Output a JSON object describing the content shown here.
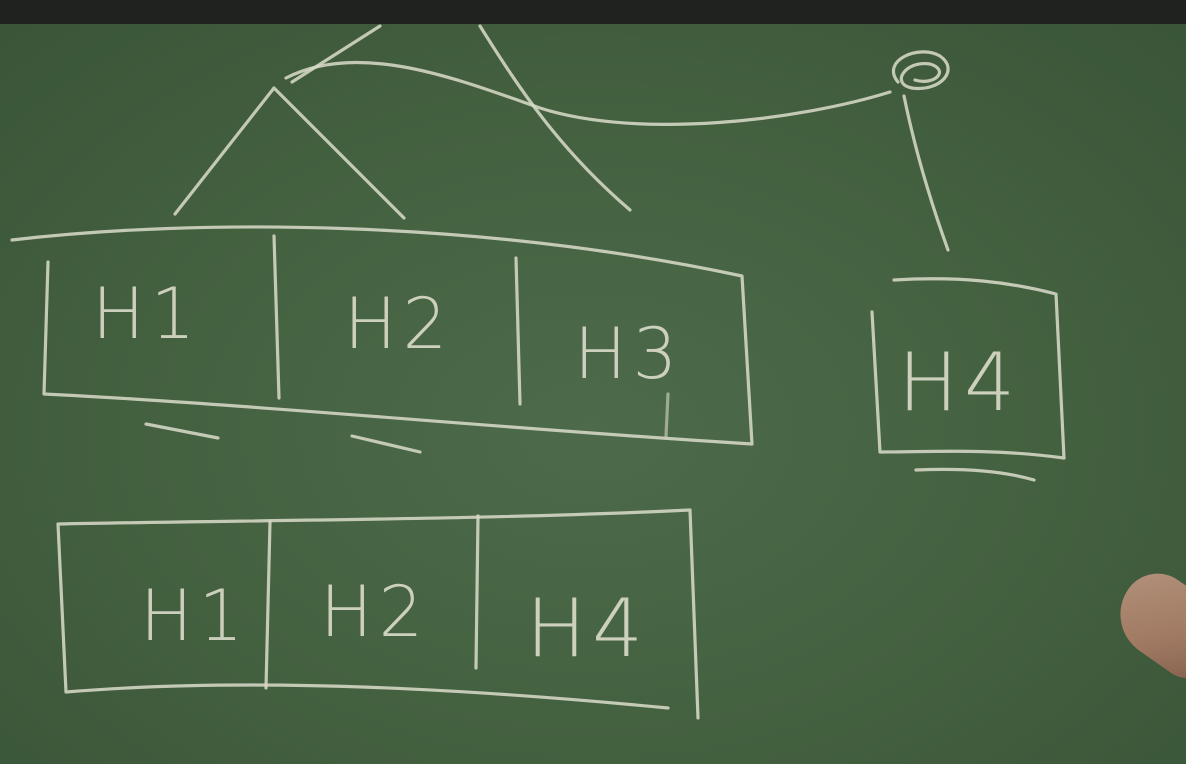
{
  "board": {
    "top_row_labels": [
      "H1",
      "H2",
      "H3"
    ],
    "side_box_label": "H4",
    "bottom_row_labels": [
      "H1",
      "H2",
      "H4"
    ]
  },
  "colors": {
    "board": "#43603f",
    "chalk": "#d6d8c6",
    "frame": "#1f221f"
  }
}
